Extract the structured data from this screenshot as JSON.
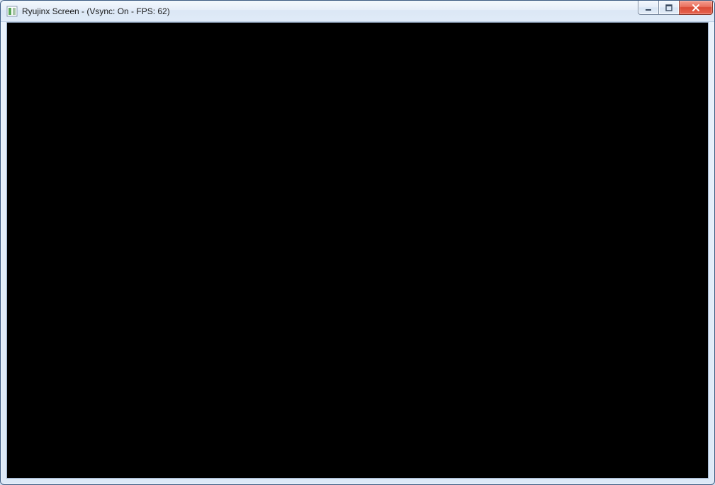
{
  "window": {
    "title": "Ryujinx Screen - (Vsync: On - FPS: 62)",
    "icon": "app-icon"
  },
  "controls": {
    "minimize": "minimize",
    "maximize": "maximize",
    "close": "close"
  }
}
